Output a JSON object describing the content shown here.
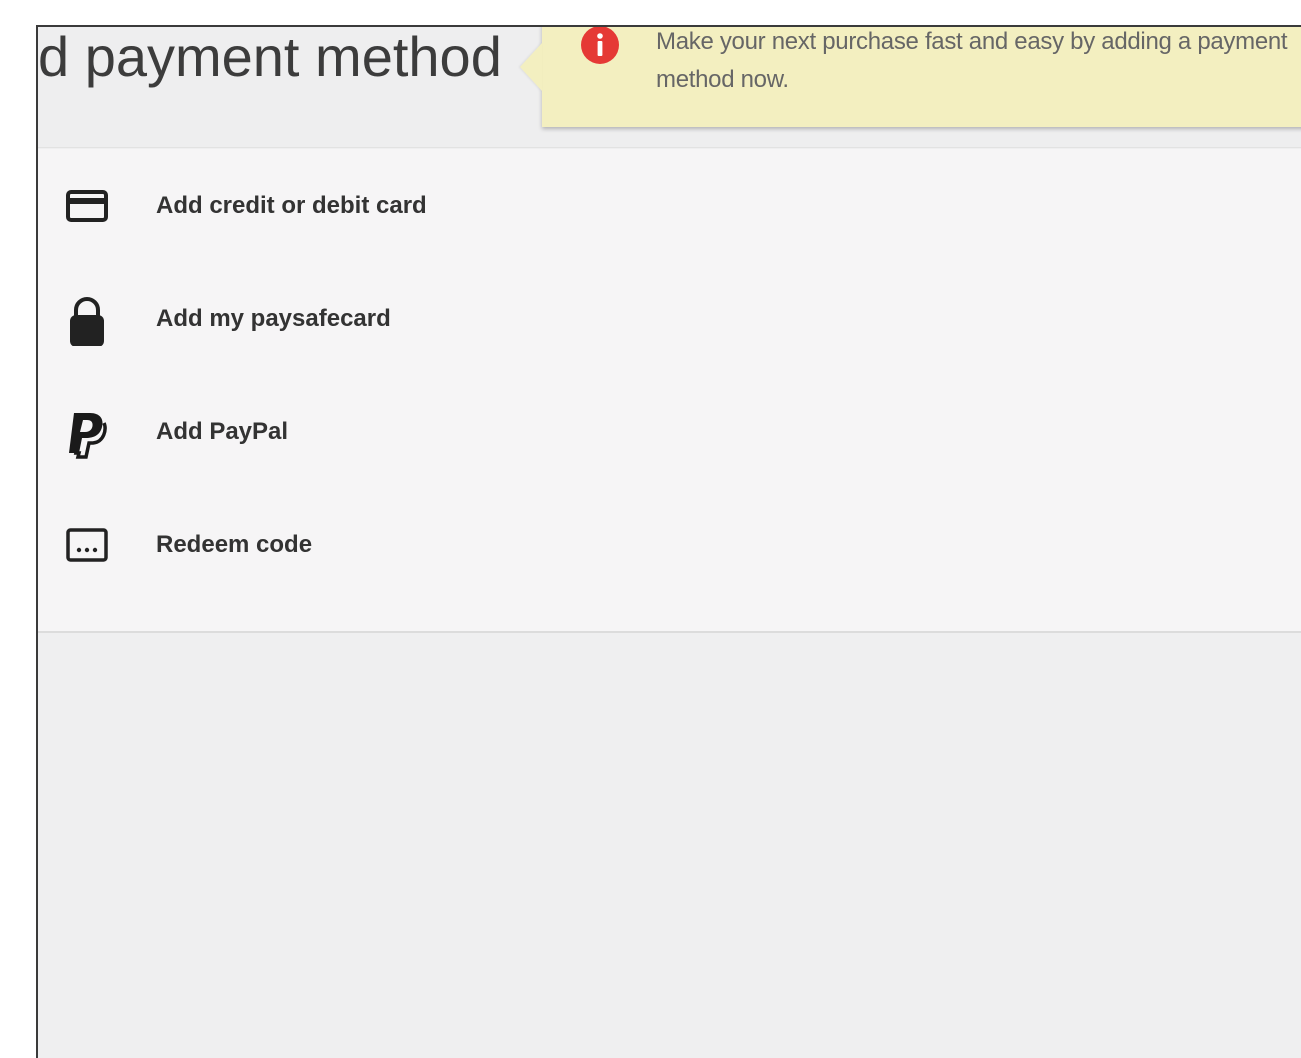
{
  "header": {
    "title": "d payment method"
  },
  "tooltip": {
    "icon": "info-icon",
    "icon_color": "#e53935",
    "background": "#f3efc0",
    "message": "Make your next purchase fast and easy by adding a payment method now."
  },
  "payment_options": [
    {
      "label": "Add credit or debit card",
      "icon": "credit-card-icon"
    },
    {
      "label": "Add my paysafecard",
      "icon": "lock-icon"
    },
    {
      "label": "Add PayPal",
      "icon": "paypal-icon"
    },
    {
      "label": "Redeem code",
      "icon": "redeem-code-icon"
    }
  ]
}
